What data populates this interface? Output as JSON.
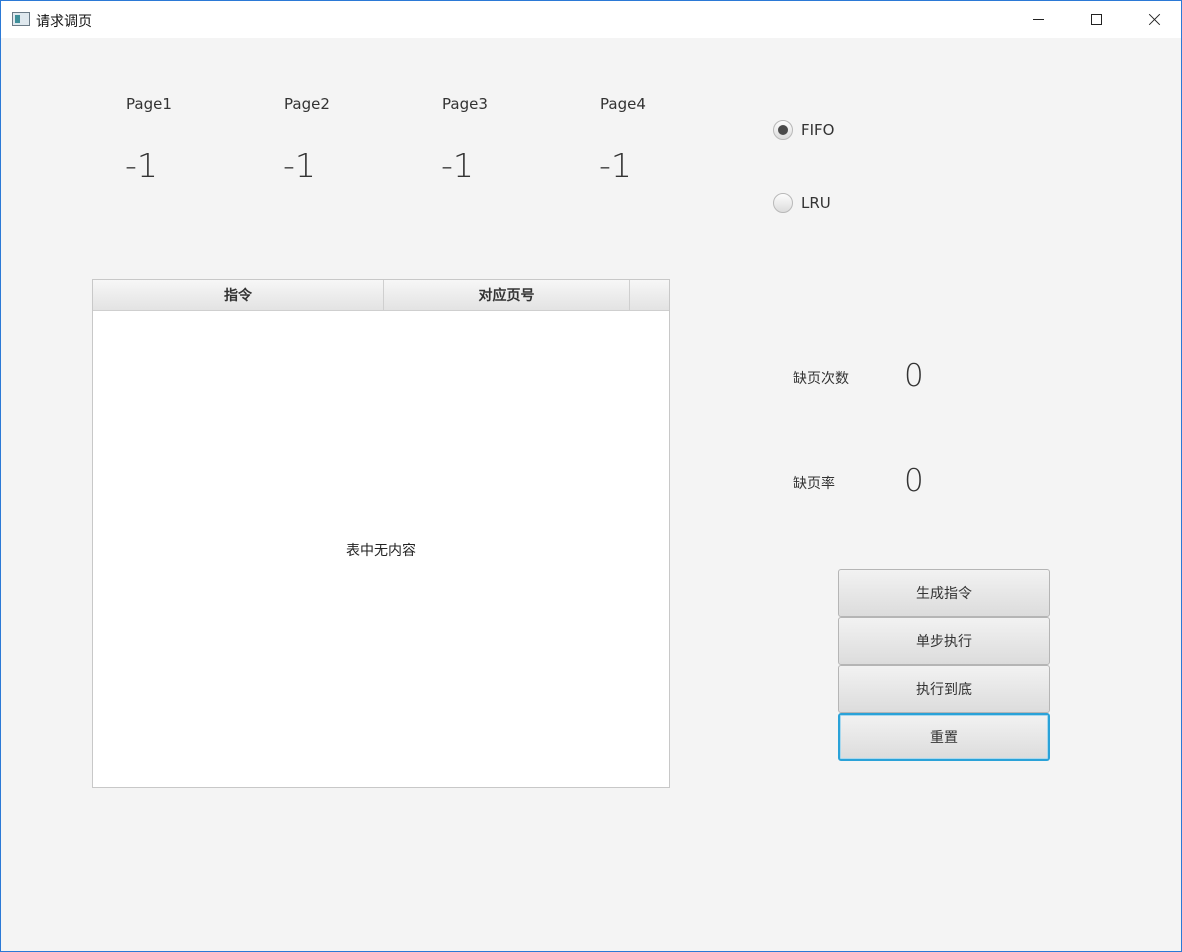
{
  "window": {
    "title": "请求调页",
    "minimize_label": "",
    "maximize_label": "",
    "close_label": ""
  },
  "pages": [
    {
      "label": "Page1",
      "value": "-1"
    },
    {
      "label": "Page2",
      "value": "-1"
    },
    {
      "label": "Page3",
      "value": "-1"
    },
    {
      "label": "Page4",
      "value": "-1"
    }
  ],
  "algorithm": {
    "options": [
      {
        "label": "FIFO",
        "selected": true
      },
      {
        "label": "LRU",
        "selected": false
      }
    ]
  },
  "table": {
    "columns": [
      "指令",
      "对应页号"
    ],
    "rows": [],
    "empty_text": "表中无内容"
  },
  "stats": {
    "page_faults_label": "缺页次数",
    "page_faults_value": "0",
    "fault_rate_label": "缺页率",
    "fault_rate_value": "0"
  },
  "buttons": {
    "generate": "生成指令",
    "step": "单步执行",
    "run_all": "执行到底",
    "reset": "重置"
  }
}
